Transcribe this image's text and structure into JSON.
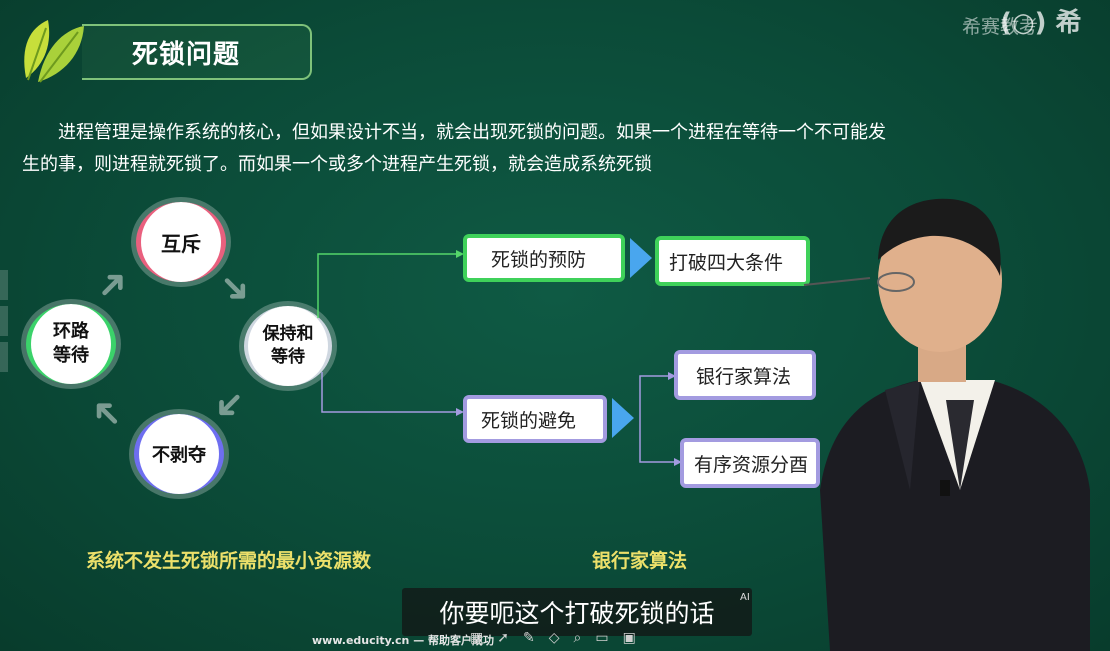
{
  "title": "死锁问题",
  "watermark": "希赛教考",
  "paragraph": "进程管理是操作系统的核心，但如果设计不当，就会出现死锁的问题。如果一个进程在等待一个不可能发生的事，则进程就死锁了。而如果一个或多个进程产生死锁，就会造成系统死锁",
  "cycle": {
    "mutex": "互斥",
    "hold_wait": "保持和等待",
    "no_preempt": "不剥夺",
    "loop_wait": "环路等待"
  },
  "branches": {
    "prevent": "死锁的预防",
    "break_four": "打破四大条件",
    "avoid": "死锁的避免",
    "banker": "银行家算法",
    "ordered": "有序资源分酉"
  },
  "links": {
    "min_resources": "系统不发生死锁所需的最小资源数",
    "banker_algo": "银行家算法"
  },
  "subtitle": "你要呃这个打破死锁的话",
  "ai_badge": "AI",
  "footer": "www.educity.cn — 帮助客户成功",
  "colors": {
    "background": "#0b4b38",
    "accent_green": "#3fd15a",
    "accent_purple": "#a39be0",
    "link_yellow": "#ece06a"
  }
}
